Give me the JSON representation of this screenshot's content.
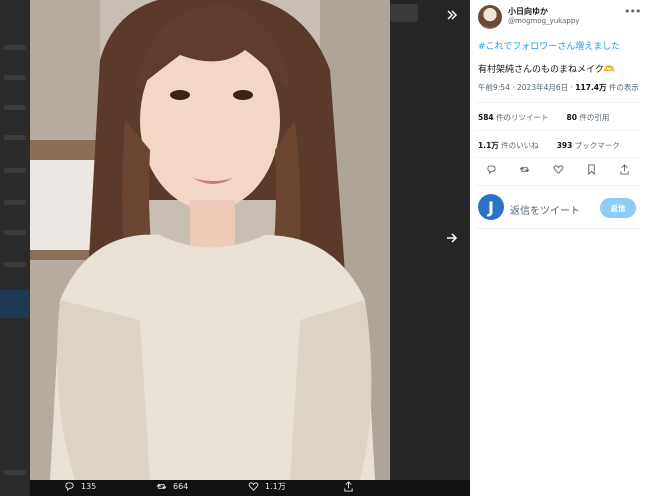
{
  "author": {
    "name": "小日向ゆか",
    "handle": "@mogmog_yukappy"
  },
  "tweet": {
    "hashtag": "#これでフォロワーさん増えました",
    "text": "有村架純さんのものまねメイク🫶",
    "time": "午前9:54",
    "date": "2023年4月6日",
    "views_count": "117.4万",
    "views_label": "件の表示"
  },
  "stats": {
    "retweets_count": "584",
    "retweets_label": "件のリツイート",
    "quotes_count": "80",
    "quotes_label": "件の引用",
    "likes_count": "1.1万",
    "likes_label": "件のいいね",
    "bookmarks_count": "393",
    "bookmarks_label": "ブックマーク"
  },
  "reply": {
    "avatar_letter": "J",
    "placeholder": "返信をツイート",
    "button": "返信"
  },
  "media_bar": {
    "replies": "135",
    "retweets": "664",
    "likes": "1.1万"
  },
  "colors": {
    "accent": "#1d9bf0",
    "reply_button": "#8ecdf8",
    "avatar_j": "#2c72c7"
  }
}
